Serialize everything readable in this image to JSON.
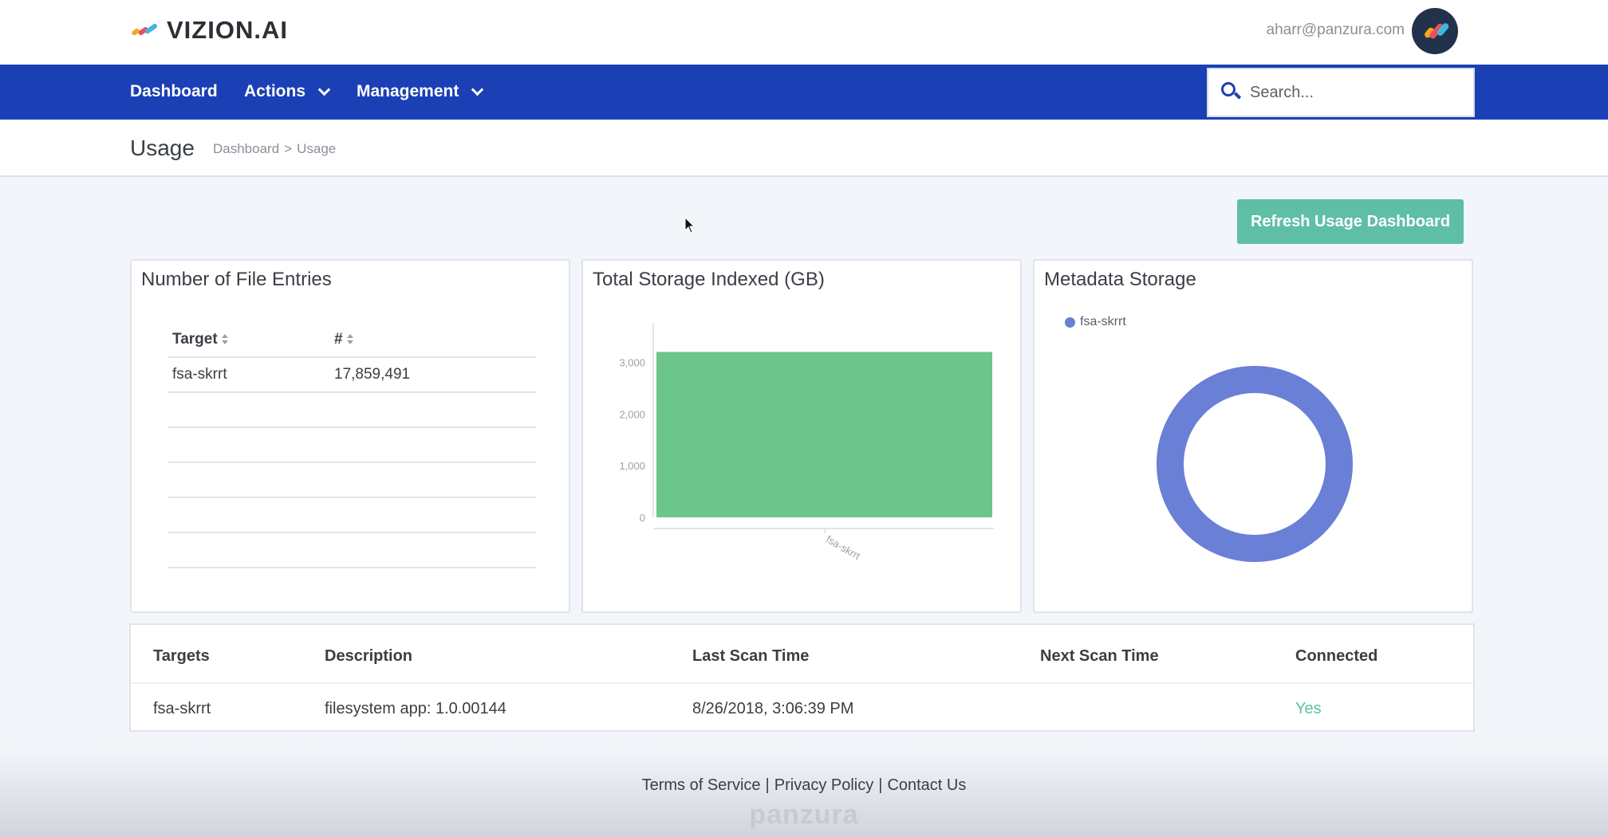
{
  "app": {
    "logo_text": "VIZION.AI",
    "user_email": "aharr@panzura.com"
  },
  "nav": {
    "items": [
      {
        "label": "Dashboard"
      },
      {
        "label": "Actions"
      },
      {
        "label": "Management"
      }
    ],
    "search_placeholder": "Search..."
  },
  "page": {
    "title": "Usage",
    "breadcrumb": [
      "Dashboard",
      ">",
      "Usage"
    ],
    "refresh_label": "Refresh Usage Dashboard"
  },
  "file_entries": {
    "title": "Number of File Entries",
    "columns": [
      "Target",
      "#"
    ],
    "rows": [
      {
        "target": "fsa-skrrt",
        "count": "17,859,491"
      }
    ]
  },
  "storage": {
    "title": "Total Storage Indexed (GB)"
  },
  "metadata": {
    "title": "Metadata Storage",
    "legend": "fsa-skrrt"
  },
  "chart_data": [
    {
      "type": "bar",
      "title": "Total Storage Indexed (GB)",
      "categories": [
        "fsa-skrrt"
      ],
      "values": [
        3200
      ],
      "ylim": [
        0,
        3300
      ],
      "yticks": [
        "3,000",
        "2,000",
        "1,000",
        "0"
      ],
      "color": "#6cc58a"
    },
    {
      "type": "pie",
      "title": "Metadata Storage",
      "categories": [
        "fsa-skrrt"
      ],
      "values": [
        100
      ],
      "color": "#6a7fd6"
    }
  ],
  "targets_table": {
    "columns": [
      "Targets",
      "Description",
      "Last Scan Time",
      "Next Scan Time",
      "Connected"
    ],
    "rows": [
      {
        "target": "fsa-skrrt",
        "description": "filesystem app: 1.0.00144",
        "last_scan": "8/26/2018, 3:06:39 PM",
        "next_scan": "",
        "connected": "Yes"
      }
    ]
  },
  "footer": {
    "links": [
      "Terms of Service",
      "Privacy Policy",
      "Contact Us"
    ],
    "separator": "|",
    "brand": "panzura"
  },
  "colors": {
    "nav_bg": "#1b3fb5",
    "accent": "#5fbfa6",
    "bar": "#6cc58a",
    "donut": "#6a7fd6"
  }
}
